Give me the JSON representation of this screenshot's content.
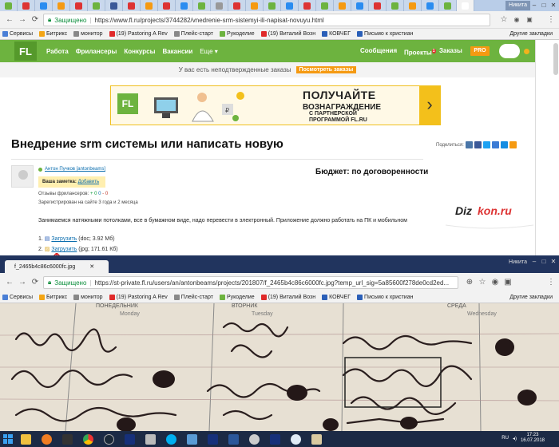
{
  "browser1": {
    "user_badge": "Никита",
    "security_label": "Защищено",
    "url": "https://www.fl.ru/projects/3744282/vnedrenie-srm-sistemyi-ili-napisat-novuyu.html",
    "tab_colors": [
      "#6db33f",
      "#d33",
      "#2a8cf0",
      "#f59a12",
      "#d33",
      "#6db33f",
      "#3b5998",
      "#d33",
      "#f59a12",
      "#d33",
      "#2a8cf0",
      "#6db33f",
      "#999",
      "#d33",
      "#f59a12",
      "#6db33f",
      "#2a8cf0",
      "#d33",
      "#6db33f",
      "#f59a12",
      "#2a8cf0",
      "#d33",
      "#6db33f",
      "#f59a12",
      "#2a8cf0",
      "#6db33f",
      "#ffffff"
    ]
  },
  "bookmarks": [
    {
      "label": "Сервисы",
      "color": "#4a7fd6"
    },
    {
      "label": "Битрикс",
      "color": "#f3a515"
    },
    {
      "label": "монитор",
      "color": "#888888"
    },
    {
      "label": "(19) Pastoring A Rev",
      "color": "#e02a2a"
    },
    {
      "label": "Плейс-старт",
      "color": "#888888"
    },
    {
      "label": "Рукоделие",
      "color": "#6db33f"
    },
    {
      "label": "(19) Виталий Возн",
      "color": "#e02a2a"
    },
    {
      "label": "КОВЧЕГ",
      "color": "#2a5fb8"
    },
    {
      "label": "Письмо к христиан",
      "color": "#2a5fb8"
    }
  ],
  "bookmarks1_other": "Другие закладки",
  "bookmarks2": [
    {
      "label": "Сервисы",
      "color": "#4a7fd6"
    },
    {
      "label": "Битрикс",
      "color": "#f3a515"
    },
    {
      "label": "монитор",
      "color": "#888888"
    },
    {
      "label": "(19) Pastoring A Rev",
      "color": "#e02a2a"
    },
    {
      "label": "Плейс-старт",
      "color": "#888888"
    },
    {
      "label": "Рукоделие",
      "color": "#6db33f"
    },
    {
      "label": "(19) Виталий Возн",
      "color": "#e02a2a"
    },
    {
      "label": "КОВЧЕГ",
      "color": "#2a5fb8"
    },
    {
      "label": "Письмо к христиан",
      "color": "#2a5fb8"
    }
  ],
  "bookmarks2_other": "Другие закладки",
  "site": {
    "logo": "FL",
    "nav": [
      "Работа",
      "Фрилансеры",
      "Конкурсы",
      "Вакансии",
      "Еще"
    ],
    "right_nav": [
      "Сообщения",
      "Проекты",
      "Заказы"
    ],
    "projects_count": "1",
    "pro": "PRO",
    "notice_text": "У вас есть неподтвержденные заказы",
    "notice_button": "Посмотреть заказы",
    "banner": {
      "logo": "FL",
      "line1": "ПОЛУЧАЙТЕ",
      "line2": "ВОЗНАГРАЖДЕНИЕ",
      "line3": "С ПАРТНЕРСКОЙ",
      "line4": "ПРОГРАММОЙ FL.RU"
    },
    "project": {
      "title": "Внедрение srm системы или написать новую",
      "share_label": "Поделиться:",
      "user": "Антон Пучков [antonbeams]",
      "note_label": "Ваша заметка:",
      "note_action": "Добавить",
      "reviews_label": "Отзывы фрилансеров:",
      "reviews_pos": "+ 0",
      "reviews_neu": "0",
      "reviews_neg": "- 0",
      "registered": "Зарегистрирован на сайте 3 года и 2 месяца",
      "budget": "Бюджет: по договоренности",
      "description": "Занимаемся натяжными потолками, все в бумажном виде, надо перевести в электронный. Приложение должно работать на ПК и мобильном",
      "files": [
        {
          "num": "1.",
          "link": "Загрузить",
          "meta": "(doc; 3.92 Мб)"
        },
        {
          "num": "2.",
          "link": "Загрузить",
          "meta": "(jpg; 171.61 Кб)"
        }
      ]
    },
    "ad_logo_1": "Diz",
    "ad_logo_2": "kon.ru"
  },
  "browser2": {
    "user_badge": "Никита",
    "tab_title": "f_2465b4c86c6000fc.jpg",
    "security_label": "Защищено",
    "url": "https://st-private.fl.ru/users/an/antonbeams/projects/201807/f_2465b4c86c6000fc.jpg?temp_url_sig=5a85600f278de0cd2ed..."
  },
  "photo_text": {
    "day1": "ПОНЕДЕЛЬНИК",
    "day1_en": "Monday",
    "day2": "ВТОРНИК",
    "day2_en": "Tuesday",
    "day3": "СРЕДА",
    "day3_en": "Wednesday"
  },
  "taskbar": {
    "lang": "RU",
    "time": "17:23",
    "date": "16.07.2018",
    "icons": [
      "windows-explorer",
      "firefox",
      "terminal",
      "chrome",
      "steam",
      "media-player",
      "tools",
      "skype",
      "photos",
      "media-player-2",
      "word",
      "disc",
      "photos-2",
      "browser-2",
      "settings"
    ]
  }
}
